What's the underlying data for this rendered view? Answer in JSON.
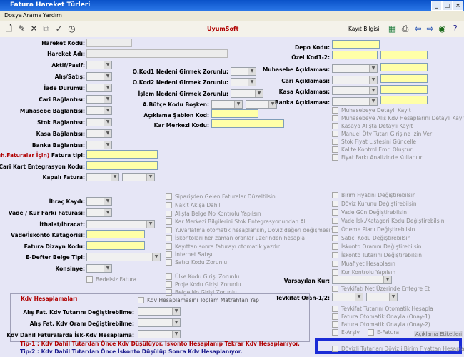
{
  "window": {
    "title": "Fatura Hareket Türleri",
    "min_icon": "minimize-icon",
    "max_icon": "maximize-icon",
    "close_icon": "close-icon"
  },
  "menu": {
    "items": [
      "Dosya",
      "Arama",
      "Yardım"
    ]
  },
  "toolbar": {
    "brand": "UyumSoft",
    "record_info": "Kayıt Bilgisi"
  },
  "left": {
    "hareket_kodu": "Hareket Kodu:",
    "hareket_adi": "Hareket Adı:",
    "aktif_pasif": "Aktif/Pasif:",
    "alis_satis": "Alış/Satış:",
    "iade_durumu": "İade Durumu:",
    "cari_baglantisi": "Cari Bağlantısı:",
    "muhasebe_baglantisi": "Muhasebe Bağlantısı:",
    "stok_baglantisi": "Stok Bağlantısı:",
    "kasa_baglantisi": "Kasa Bağlantısı:",
    "banka_baglantisi": "Banka Bağlantısı:",
    "fatura_tipi_prefix": "(Muh.Faturalar İçin)",
    "fatura_tipi": " Fatura tipi:",
    "cari_kart_entegrasyon": "Cari Kart Entegrasyon Kodu:",
    "kapali_fatura": "Kapalı Fatura:",
    "ihrac_kaydi": "İhraç Kaydı:",
    "vade_kur_farki": "Vade / Kur Farkı Faturası:",
    "ithalat_ihracat": "İthalat/İhracat:",
    "vade_iskonto_kategorisi": "Vade/İskonto Katagorisi:",
    "fatura_dizayn_kodu": "Fatura Dizayn Kodu:",
    "edefter_belge_tipi": "E-Defter Belge Tipi:",
    "konsinye": "Konsinye:",
    "bedelsiz_fatura": "Bedelsiz Fatura"
  },
  "middle": {
    "okod1": "O.Kod1 Nedeni Girmek Zorunlu:",
    "okod2": "O.Kod2 Nedeni Girmek Zorunlu:",
    "islem_nedeni": "İşlem Nedeni Girmek Zorunlu:",
    "abutce": "A.Bütçe Kodu Boşken:",
    "aciklama_sablon": "Açıklama Şablon Kod:",
    "kar_merkezi": "Kar Merkezi Kodu:"
  },
  "right": {
    "depo_kodu": "Depo Kodu:",
    "ozel_kod": "Özel Kod1-2:",
    "muhasebe_aciklamasi": "Muhasebe Açıklaması:",
    "cari_aciklamasi": "Cari Açıklaması:",
    "kasa_aciklamasi": "Kasa Açıklaması:",
    "banka_aciklamasi": "Banka Açıklaması:",
    "varsayilan_kur": "Varsayılan Kur:",
    "tevkifat_orani": "Tevkifat Oran-1/2:",
    "aciklama_etiketleri": "Açıklama Etiketleri"
  },
  "checks_right_top": [
    "Muhasebeye Detaylı Kayıt",
    "Muhasebeye Alış Kdv Hesaplarını Detaylı Kayıt",
    "Kasaya Alışta Detaylı Kayıt",
    "Manuel Ötv Tutarı Girişine İzin Ver",
    "Stok Fiyat Listesini Güncelle",
    "Kalite Kontrol Emri Oluştur",
    "Fiyat Farkı Analizinde Kullanılır"
  ],
  "checks_middle": [
    "Siparişden Gelen Faturalar Düzeltilsin",
    "Nakit Akışa Dahil",
    "Alışta Belge No Kontrolu Yapılsın",
    "Kar Merkezi Bilgilerini Stok Entegrasyonundan Al",
    "Yuvarlatma otomatik hesaplansın, Döviz değeri değişmesin",
    "İskontoları her zaman oranlar üzerinden hesapla",
    "Kayıttan sonra faturayı otomatik yazdır",
    "İnternet Satışı",
    "Satıcı Kodu Zorunlu"
  ],
  "checks_middle_b": [
    "Ülke Kodu Girişi Zorunlu",
    "Proje Kodu Girişi Zorunlu",
    "Belge No Girişi Zorunlu"
  ],
  "checks_right_mid": [
    "Birim Fiyatını Değiştirebilsin",
    "Döviz Kurunu Değiştirebilsin",
    "Vade Gün Değiştirebilsin",
    "Vade İsk./Katagori Kodu Değiştirebilsin",
    "Ödeme Planı Değiştirebilsin",
    "Satıcı Kodu Değiştirebilsin",
    "İskonto Oranını Değiştirebilsin",
    "İskonto Tutarını Değiştirebilsin",
    "Muafiyet Hesaplasın",
    "Kur Kontrolu Yapılsın"
  ],
  "tevkifat_check": "Tevkifatı Net Üzerinde Entegre Et",
  "checks_right_bottom": [
    "Tevkifat Tutarını Otomatik Hesapla",
    "Fatura Otomatik Onayla (Onay-1)",
    "Fatura Otomatik Onayla (Onay-2)"
  ],
  "earsiv": "E-Arşiv",
  "efatura": "E-Fatura",
  "highlighted_check": "Dövizli Tutarları Dövizli Birim Fiyattan Hesapla",
  "kdv": {
    "title": "Kdv Hesaplamaları",
    "toplam_matrah": "Kdv Hesaplamasını Toplam Matrahtan Yap",
    "alis_tutar": "Alış Fat. Kdv Tutarını Değiştirebilme:",
    "alis_oran": "Alış Fat. Kdv Oranı Değiştirebilme:",
    "kdv_dahil": "Kdv Dahil Faturalarda İsk-Kdv Hesaplama:"
  },
  "tips": {
    "tip1": "Tip-1 : Kdv Dahil Tutardan Önce Kdv Düşülüyor.  İskonto Hesaplanıp Tekrar Kdv Hesaplanıyor.",
    "tip2": "Tip-2 : Kdv Dahil Tutardan Önce İskonto Düşülüp Sonra Kdv Hesaplanıyor."
  },
  "colors": {
    "form_bg": "#e6e6f6",
    "required_field": "#ffffa8",
    "highlight_border": "#1a2bd6",
    "title_bar": "#0a52c8"
  }
}
